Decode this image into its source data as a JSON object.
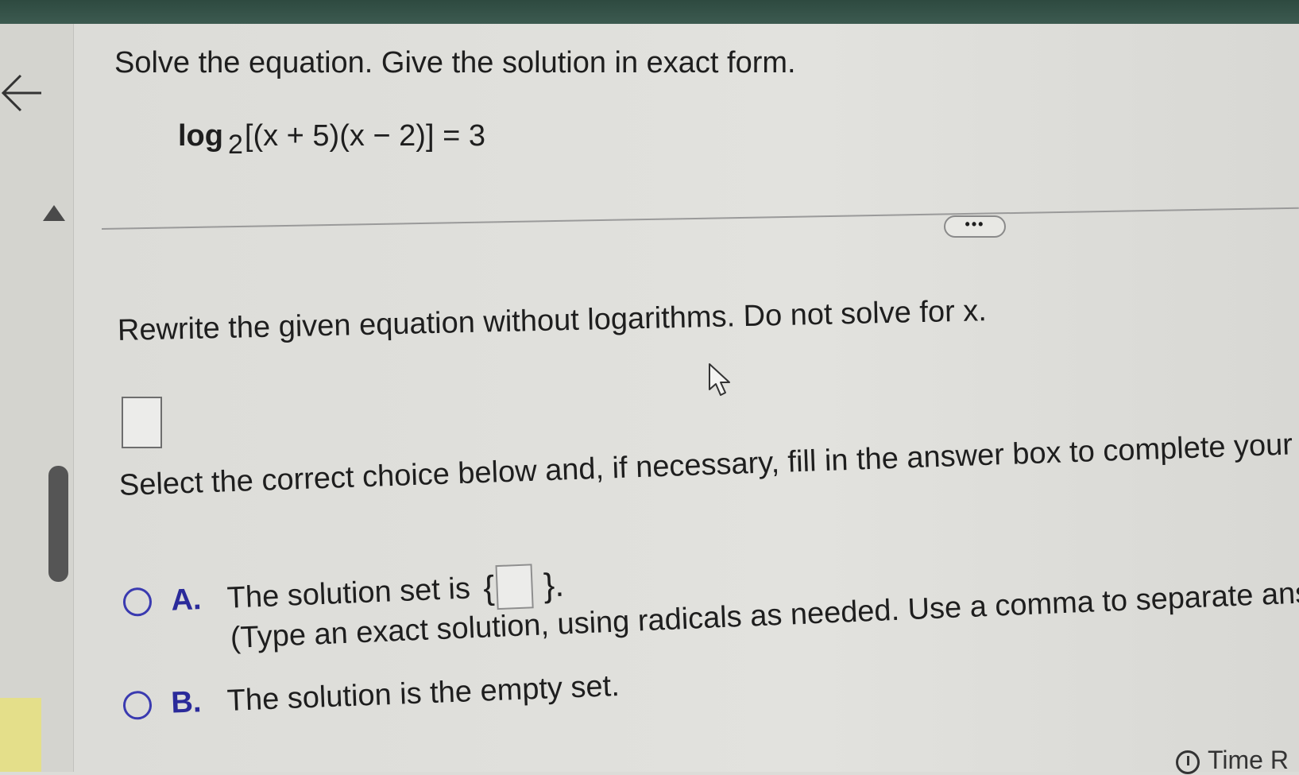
{
  "problem": {
    "instruction": "Solve the equation. Give the solution in exact form.",
    "equation": {
      "func": "log",
      "base": "2",
      "argument": "[(x + 5)(x − 2)] = 3"
    }
  },
  "toolbar": {
    "more_label": "•••"
  },
  "rewrite": {
    "prompt": "Rewrite the given equation without logarithms. Do not solve for x.",
    "answer_value": ""
  },
  "choices": {
    "prompt": "Select the correct choice below and, if necessary, fill in the answer box to complete your choice.",
    "a": {
      "letter": "A.",
      "text": "The solution set is",
      "brace_open": "{",
      "brace_close": "}.",
      "answer_value": "",
      "note": "(Type an exact solution, using radicals as needed. Use a comma to separate answers as ne"
    },
    "b": {
      "letter": "B.",
      "text": "The solution is the empty set."
    }
  },
  "footer": {
    "time_label": "Time R"
  },
  "colors": {
    "accent": "#3a3ab0",
    "top_bar": "#2e4a40"
  }
}
